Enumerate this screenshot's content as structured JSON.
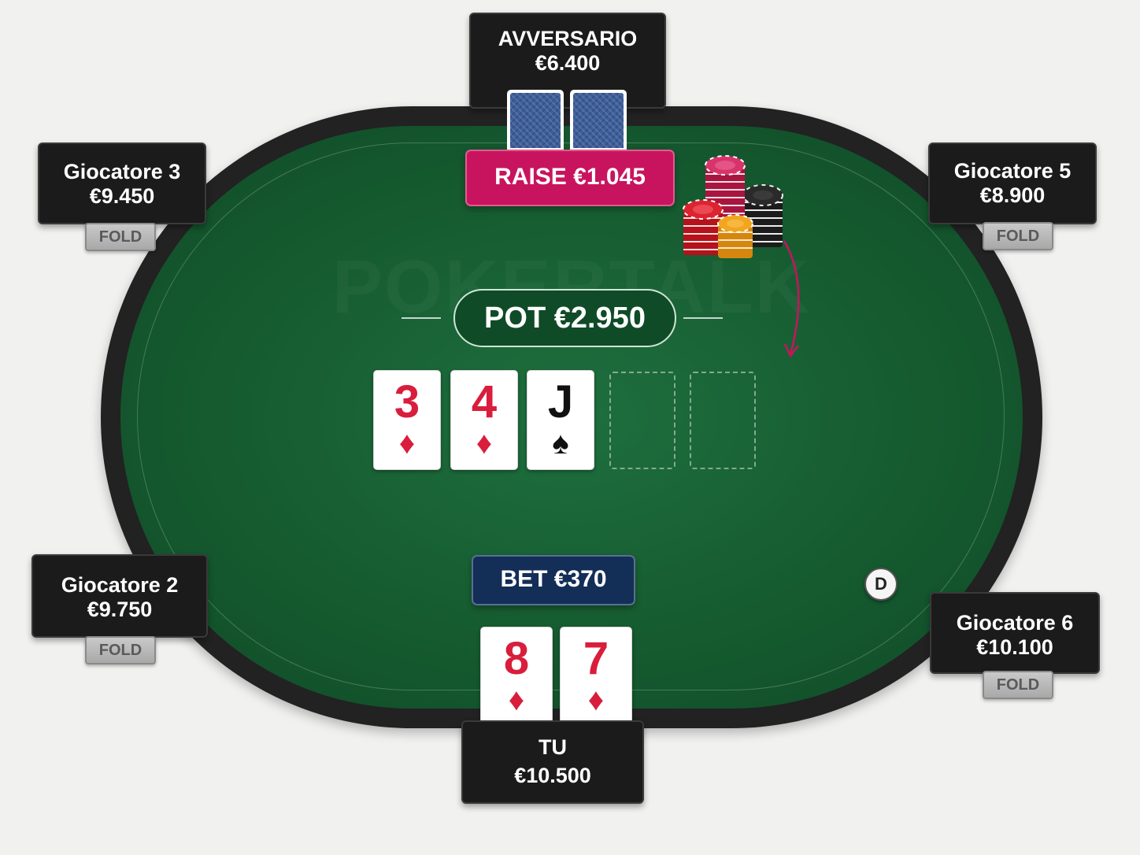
{
  "watermark": "POKERTALK",
  "pot": {
    "label": "POT €2.950"
  },
  "opponent": {
    "name": "AVVERSARIO",
    "stack": "€6.400",
    "action": "RAISE €1.045"
  },
  "hero": {
    "name": "TU",
    "stack": "€10.500",
    "action": "BET €370",
    "cards": [
      {
        "rank": "8",
        "suit": "♦",
        "color": "red"
      },
      {
        "rank": "7",
        "suit": "♦",
        "color": "red"
      }
    ]
  },
  "players": [
    {
      "name": "Giocatore 3",
      "stack": "€9.450",
      "status": "FOLD"
    },
    {
      "name": "Giocatore 5",
      "stack": "€8.900",
      "status": "FOLD"
    },
    {
      "name": "Giocatore 2",
      "stack": "€9.750",
      "status": "FOLD"
    },
    {
      "name": "Giocatore 6",
      "stack": "€10.100",
      "status": "FOLD"
    }
  ],
  "board": [
    {
      "rank": "3",
      "suit": "♦",
      "color": "red"
    },
    {
      "rank": "4",
      "suit": "♦",
      "color": "red"
    },
    {
      "rank": "J",
      "suit": "♠",
      "color": "black"
    }
  ],
  "dealer_button": "D",
  "colors": {
    "felt": "#1e6f3e",
    "raise": "#c8145e",
    "bet": "#132e57",
    "red_suit": "#d81e3c"
  }
}
